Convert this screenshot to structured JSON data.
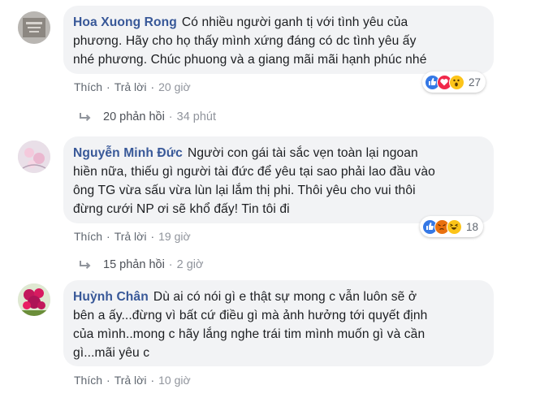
{
  "comments": [
    {
      "author": "Hoa Xuong Rong",
      "text_lines": [
        "Có nhiều người ganh tị với tình yêu của",
        "phương. Hãy cho họ thấy mình xứng đáng có dc tình yêu ấy",
        "nhé phương. Chúc phuong và a giang mãi mãi hạnh phúc nhé"
      ],
      "like_label": "Thích",
      "reply_label": "Trả lời",
      "time": "20 giờ",
      "reaction_count": "27",
      "reaction_icons": [
        "like-icon",
        "love-icon",
        "wow-icon"
      ],
      "replies_label": "20 phản hồi",
      "replies_time": "34 phút"
    },
    {
      "author": "Nguyễn Minh Đức",
      "text_lines": [
        "Người con gái tài sắc vẹn toàn lại ngoan",
        "hiền nữa, thiếu gì người tài đức để yêu tại sao phải lao đầu vào",
        "ông TG vừa sấu vừa lùn lại lắm thị phi. Thôi yêu cho vui thôi",
        "đừng cưới NP ơi sẽ khổ đấy! Tin tôi đi"
      ],
      "like_label": "Thích",
      "reply_label": "Trả lời",
      "time": "19 giờ",
      "reaction_count": "18",
      "reaction_icons": [
        "like-icon",
        "angry-icon",
        "haha-icon"
      ],
      "replies_label": "15 phản hồi",
      "replies_time": "2 giờ"
    },
    {
      "author": "Huỳnh Chân",
      "text_lines": [
        "Dù ai có nói gì e thật sự mong c vẫn luôn sẽ ở",
        "bên a ấy...đừng vì bất cứ điều gì mà ảnh hưởng tới quyết định",
        "của mình..mong c hãy lắng nghe trái tim mình muốn gì và cần",
        "gì...mãi yêu c"
      ],
      "like_label": "Thích",
      "reply_label": "Trả lời",
      "time": "10 giờ"
    }
  ],
  "separator": "·",
  "colors": {
    "author": "#385898",
    "bubble": "#f2f3f5",
    "meta": "#606770",
    "like_blue": "#3578e5",
    "love_red": "#f0284a",
    "emoji_yellow": "#fcc419",
    "angry_orange": "#e9710f"
  }
}
